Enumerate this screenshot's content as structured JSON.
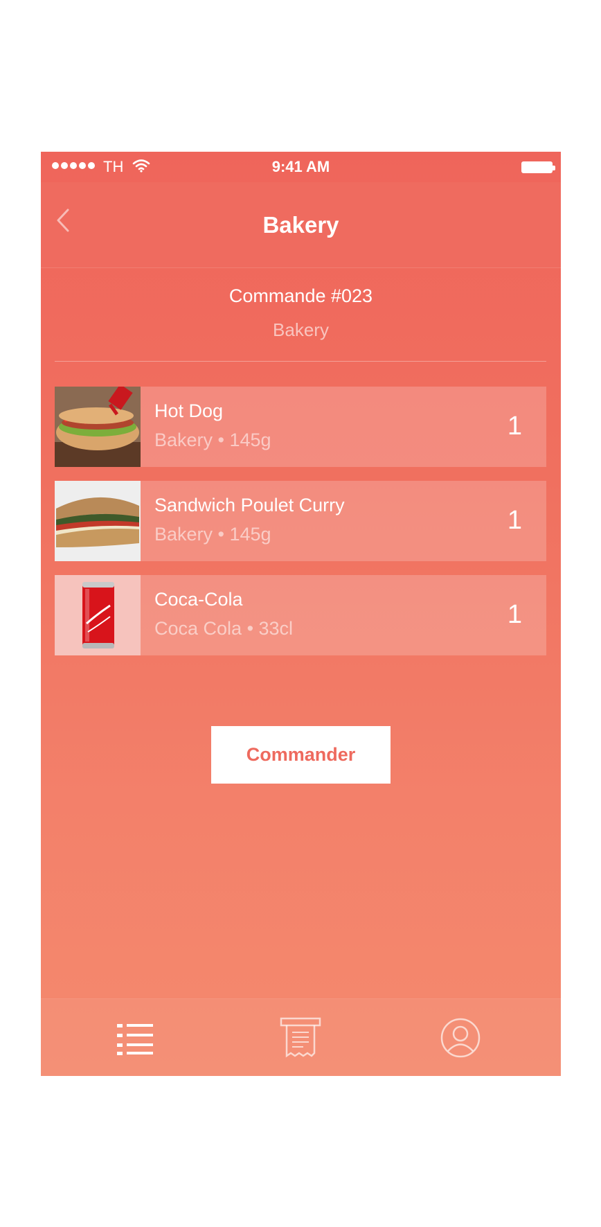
{
  "status_bar": {
    "carrier": "TH",
    "time": "9:41 AM",
    "signal_icon": "signal-dots-icon",
    "wifi_icon": "wifi-icon",
    "battery_icon": "battery-icon"
  },
  "nav": {
    "title": "Bakery",
    "back_icon": "chevron-left-icon"
  },
  "order": {
    "title": "Commande #023",
    "subtitle": "Bakery"
  },
  "items": [
    {
      "name": "Hot Dog",
      "meta": "Bakery • 145g",
      "qty": "1",
      "image": "hot-dog-image"
    },
    {
      "name": "Sandwich Poulet Curry",
      "meta": "Bakery • 145g",
      "qty": "1",
      "image": "sandwich-image"
    },
    {
      "name": "Coca-Cola",
      "meta": "Coca Cola • 33cl",
      "qty": "1",
      "image": "coca-cola-can-image"
    }
  ],
  "cta": {
    "label": "Commander"
  },
  "tabbar": {
    "tabs": [
      {
        "icon": "list-icon"
      },
      {
        "icon": "receipt-icon"
      },
      {
        "icon": "user-icon"
      }
    ]
  },
  "colors": {
    "background_top": "#ef655b",
    "background_bottom": "#f48a6e",
    "button_background": "#ffffff",
    "button_text": "#ee6a5e"
  }
}
